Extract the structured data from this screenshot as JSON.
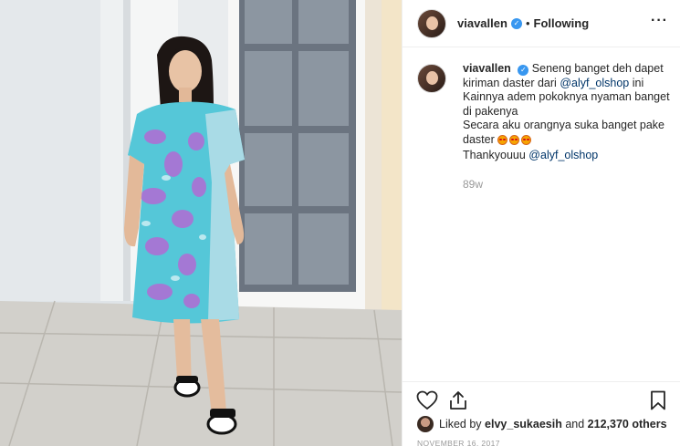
{
  "header": {
    "username": "viavallen",
    "separator": "•",
    "follow_status": "Following",
    "more_label": "···"
  },
  "caption": {
    "username": "viavallen",
    "line1_text": "Seneng banget deh dapet kiriman daster dari",
    "line1_mention": "@alyf_olshop",
    "line1_tail": "ini",
    "line2": "Kainnya adem pokoknya nyaman banget di pakenya",
    "line3": "Secara aku orangnya suka banget pake daster",
    "line4_text": "Thankyouuu",
    "line4_mention": "@alyf_olshop",
    "time_ago": "89w"
  },
  "likes": {
    "prefix": "Liked by",
    "user": "elvy_sukaesih",
    "middle": "and",
    "count": "212,370 others"
  },
  "date": "NOVEMBER 16, 2017",
  "icons": {
    "like": "heart-icon",
    "share": "share-icon",
    "save": "bookmark-icon",
    "verified": "verified-badge-icon",
    "emoji": "star-struck-emoji-icon"
  },
  "colors": {
    "verified": "#3897f0",
    "mention": "#003569",
    "muted": "#999999",
    "text": "#262626"
  }
}
